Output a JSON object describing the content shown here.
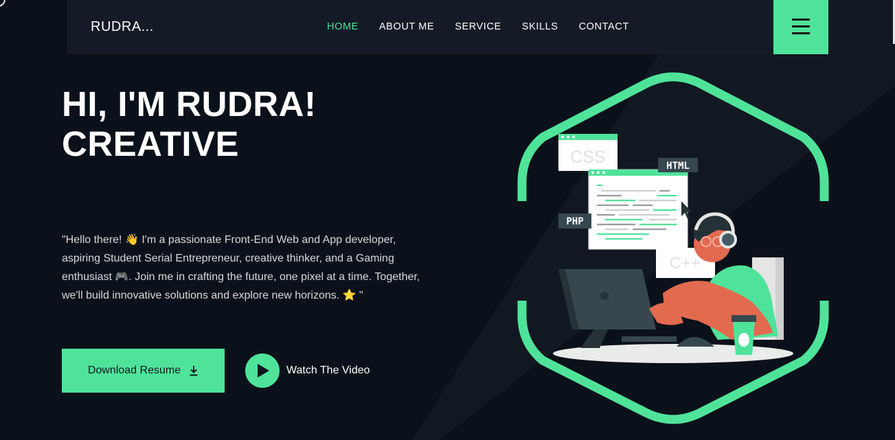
{
  "nav": {
    "logo": "RUDRA...",
    "items": [
      {
        "label": "HOME",
        "active": true
      },
      {
        "label": "ABOUT ME",
        "active": false
      },
      {
        "label": "SERVICE",
        "active": false
      },
      {
        "label": "SKILLS",
        "active": false
      },
      {
        "label": "CONTACT",
        "active": false
      }
    ],
    "menu_icon": "hamburger-menu-icon"
  },
  "hero": {
    "title_line1": "HI, I'M RUDRA!",
    "title_line2": "CREATIVE",
    "intro": "\"Hello there! 👋 I'm a passionate Front-End Web and App developer, aspiring Student Serial Entrepreneur, creative thinker, and a Gaming enthusiast 🎮. Join me in crafting the future, one pixel at a time. Together, we'll build innovative solutions and explore new horizons. ⭐ \"",
    "download_label": "Download Resume",
    "download_icon": "download-icon",
    "watch_label": "Watch The Video",
    "watch_icon": "play-icon"
  },
  "illustration": {
    "labels": [
      "CSS",
      "HTML",
      "PHP",
      "C++"
    ]
  },
  "colors": {
    "accent": "#4fe39a",
    "background": "#0b111a",
    "navbar": "#141b27",
    "person_skin": "#e26a4f"
  }
}
